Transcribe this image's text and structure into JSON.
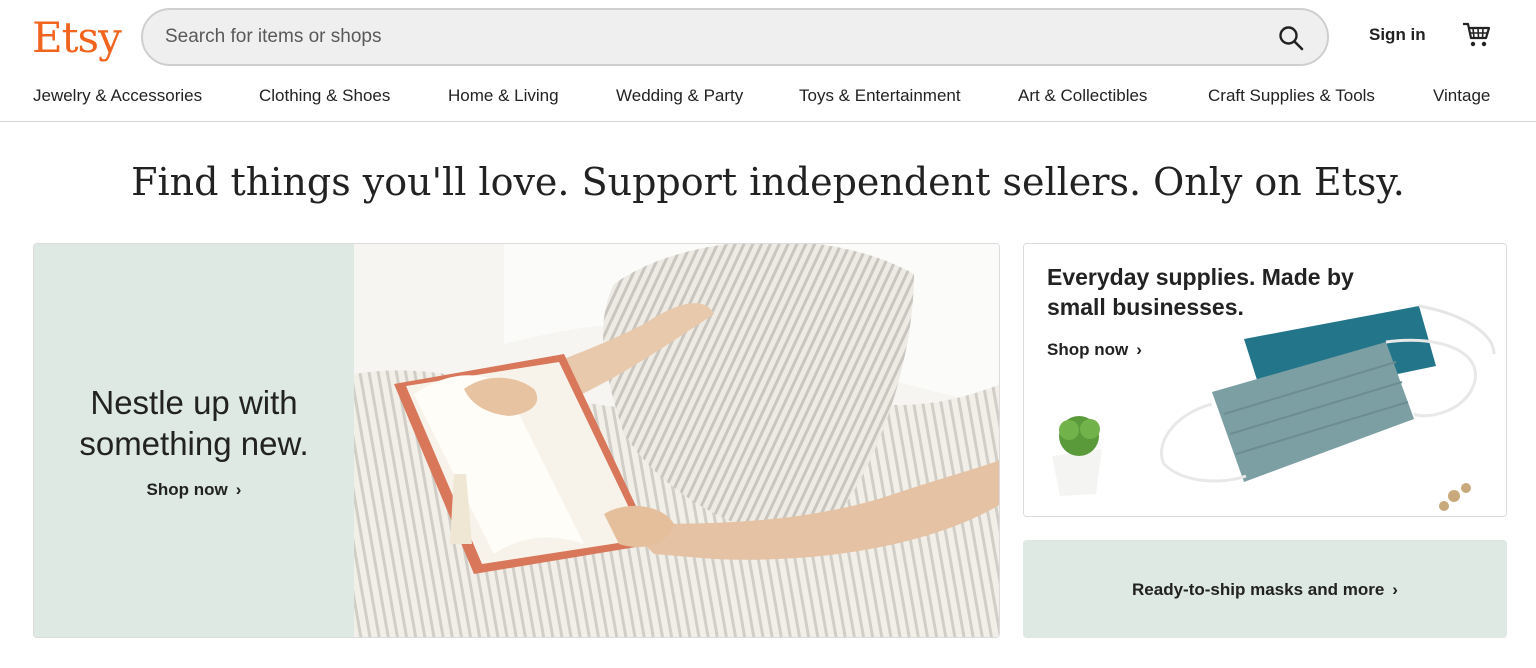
{
  "brand": {
    "logo": "Etsy",
    "accent": "#f1641e",
    "mint": "#dde9e2"
  },
  "header": {
    "search_placeholder": "Search for items or shops",
    "signin_label": "Sign in"
  },
  "nav": {
    "items": [
      {
        "label": "Jewelry & Accessories"
      },
      {
        "label": "Clothing & Shoes"
      },
      {
        "label": "Home & Living"
      },
      {
        "label": "Wedding & Party"
      },
      {
        "label": "Toys & Entertainment"
      },
      {
        "label": "Art & Collectibles"
      },
      {
        "label": "Craft Supplies & Tools"
      },
      {
        "label": "Vintage"
      }
    ]
  },
  "headline": "Find things you'll love. Support independent sellers. Only on Etsy.",
  "hero": {
    "title": "Nestle up with something new.",
    "cta": "Shop now",
    "chevron": "›"
  },
  "promo1": {
    "title": "Everyday supplies. Made by small businesses.",
    "cta": "Shop now",
    "chevron": "›"
  },
  "promo2": {
    "cta": "Ready-to-ship masks and more",
    "chevron": "›"
  }
}
